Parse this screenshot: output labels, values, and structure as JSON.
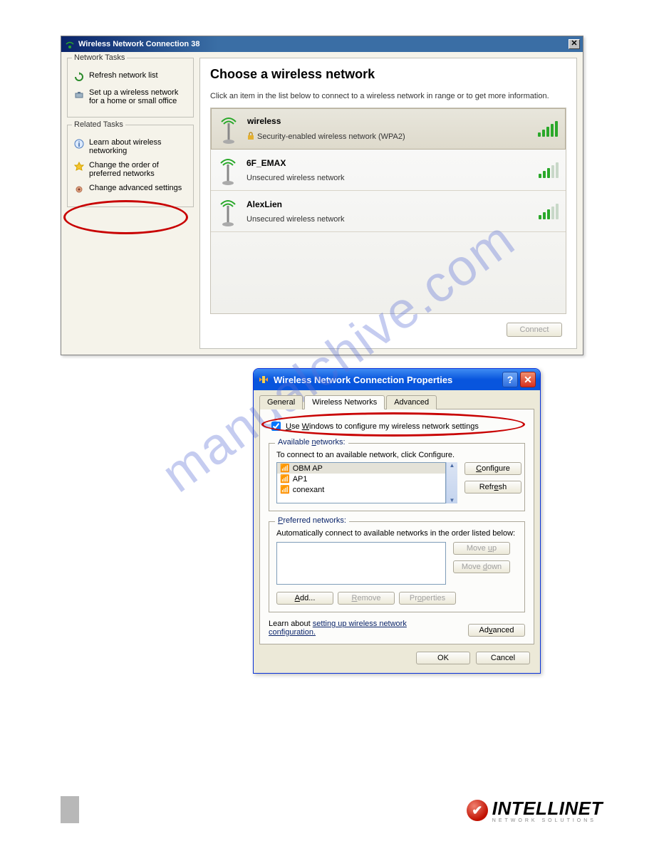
{
  "watermark": "manualchive.com",
  "win1": {
    "title": "Wireless Network Connection 38",
    "tasks": {
      "group1_title": "Network Tasks",
      "refresh": "Refresh network list",
      "setup": "Set up a wireless network for a home or small office",
      "group2_title": "Related Tasks",
      "learn": "Learn about wireless networking",
      "changeorder": "Change the order of preferred networks",
      "changeadv": "Change advanced settings"
    },
    "main_heading": "Choose a wireless network",
    "main_sub": "Click an item in the list below to connect to a wireless network in range or to get more information.",
    "networks": [
      {
        "name": "wireless",
        "detail": "Security-enabled wireless network (WPA2)",
        "bars": 5,
        "secured": true,
        "selected": true
      },
      {
        "name": "6F_EMAX",
        "detail": "Unsecured wireless network",
        "bars": 3,
        "secured": false,
        "selected": false
      },
      {
        "name": "AlexLien",
        "detail": "Unsecured wireless network",
        "bars": 3,
        "secured": false,
        "selected": false
      }
    ],
    "connect_btn": "Connect"
  },
  "win2": {
    "title": "Wireless Network Connection Properties",
    "tabs": {
      "general": "General",
      "wireless": "Wireless Networks",
      "advanced": "Advanced"
    },
    "checkbox_label": "Use Windows to configure my wireless network settings",
    "avail_title": "Available networks:",
    "avail_sub": "To connect to an available network, click Configure.",
    "avail_list": [
      "OBM AP",
      "AP1",
      "conexant"
    ],
    "configure_btn": "Configure",
    "refresh_btn": "Refresh",
    "pref_title": "Preferred networks:",
    "pref_sub": "Automatically connect to available networks in the order listed below:",
    "moveup": "Move up",
    "movedown": "Move down",
    "add": "Add...",
    "remove": "Remove",
    "properties": "Properties",
    "learn_pre": "Learn about ",
    "learn_link": "setting up wireless network configuration.",
    "advanced_btn": "Advanced",
    "ok": "OK",
    "cancel": "Cancel"
  },
  "footer": {
    "brand": "INTELLINET",
    "sub": "NETWORK SOLUTIONS"
  }
}
